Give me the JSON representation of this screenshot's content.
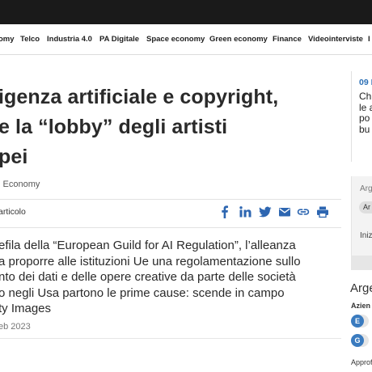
{
  "nav": {
    "items": [
      "omy",
      "Telco",
      "Industria 4.0",
      "PA Digitale",
      "Space economy",
      "Green economy",
      "Finance",
      "Videointerviste",
      "I"
    ]
  },
  "article": {
    "title_lines": [
      "igenza artificiale e copyright,",
      "e la “lobby” degli artisti",
      "pei"
    ],
    "category": "l Economy",
    "share_label": "articolo",
    "summary_lines": [
      "efila della “European Guild for AI Regulation”, l’alleanza",
      "a proporre alle istituzioni Ue una regolamentazione sullo",
      "nto dei dati e delle opere creative da parte delle società",
      "o negli Usa partono le prime cause: scende in campo",
      "ty Images"
    ],
    "date": "eb 2023"
  },
  "share": {
    "icons": [
      "facebook-icon",
      "linkedin-icon",
      "twitter-icon",
      "email-icon",
      "link-icon",
      "print-icon"
    ]
  },
  "sidebar": {
    "date": "09 N",
    "text_lines": [
      "Ch",
      "le a",
      "po",
      "bu"
    ],
    "arg_label": "Arg",
    "pill": "Ar",
    "iniz": "Iniz",
    "heading": "Arge",
    "azi": "Azien",
    "circles": [
      "E",
      "G"
    ],
    "appro": "Approf"
  },
  "colors": {
    "accent": "#2b6fb6",
    "topbar": "#1a1a1a",
    "share_blue": "#2d66b1"
  }
}
